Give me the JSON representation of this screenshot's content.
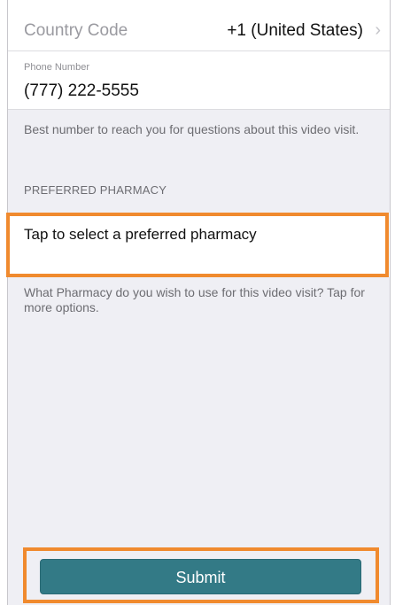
{
  "form": {
    "country_code_label": "Country Code",
    "country_code_value": "+1 (United States)",
    "country_code_chevron": "chevron-right-icon",
    "phone_label": "Phone Number",
    "phone_value": "(777) 222-5555",
    "phone_help": "Best number to reach you for questions about this video visit.",
    "pharmacy_section_header": "PREFERRED PHARMACY",
    "pharmacy_placeholder": "Tap to select a preferred pharmacy",
    "pharmacy_help": "What Pharmacy do you wish to use for this video visit? Tap for more options.",
    "submit_label": "Submit"
  },
  "colors": {
    "background": "#efeff4",
    "submit_button": "#337a86",
    "highlight": "#f08a2e"
  }
}
